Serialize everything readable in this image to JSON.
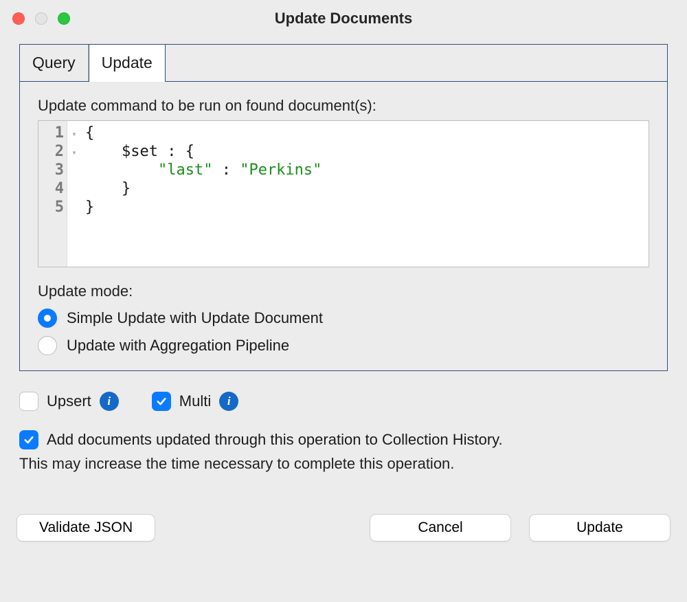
{
  "window": {
    "title": "Update Documents"
  },
  "tabs": {
    "query": "Query",
    "update": "Update",
    "active": "update"
  },
  "editor": {
    "label": "Update command to be run on found document(s):",
    "lines": [
      "{",
      "    $set : {",
      "        \"last\" : \"Perkins\"",
      "    }",
      "}"
    ],
    "line_numbers": [
      "1",
      "2",
      "3",
      "4",
      "5"
    ]
  },
  "update_mode": {
    "label": "Update mode:",
    "options": {
      "simple": "Simple Update with Update Document",
      "pipeline": "Update with Aggregation Pipeline"
    },
    "selected": "simple"
  },
  "options": {
    "upsert": {
      "label": "Upsert",
      "checked": false
    },
    "multi": {
      "label": "Multi",
      "checked": true
    },
    "info_glyph": "i"
  },
  "history": {
    "label": "Add documents updated through this operation to Collection History.",
    "checked": true,
    "note": "This may increase the time necessary to complete this operation."
  },
  "buttons": {
    "validate": "Validate JSON",
    "cancel": "Cancel",
    "update": "Update"
  }
}
